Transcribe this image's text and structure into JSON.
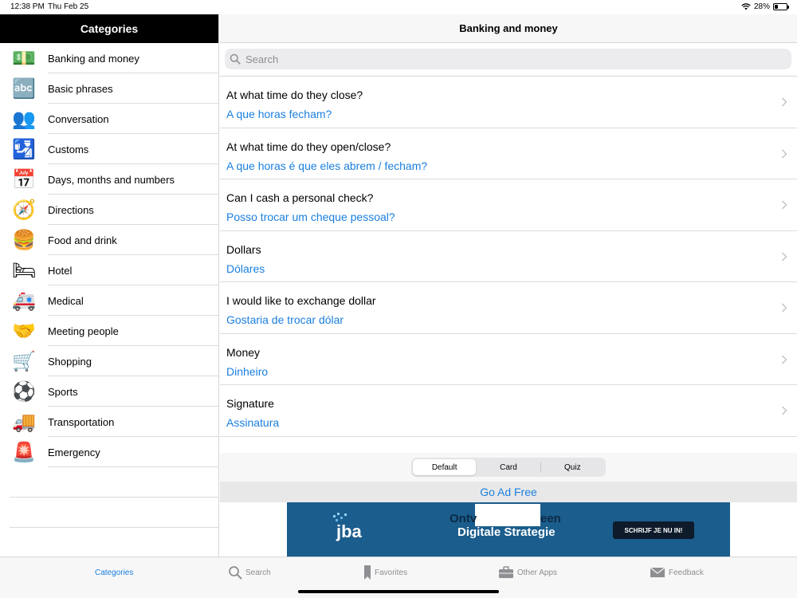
{
  "status": {
    "time": "12:38 PM",
    "date": "Thu Feb 25",
    "battery": "28%",
    "battery_level": 0.28
  },
  "sidebar": {
    "title": "Categories",
    "items": [
      {
        "label": "Banking and money",
        "icon": "money-icon"
      },
      {
        "label": "Basic phrases",
        "icon": "abc-icon"
      },
      {
        "label": "Conversation",
        "icon": "people-icon"
      },
      {
        "label": "Customs",
        "icon": "customs-officer-icon"
      },
      {
        "label": "Days, months and numbers",
        "icon": "calendar-icon"
      },
      {
        "label": "Directions",
        "icon": "compass-icon"
      },
      {
        "label": "Food and drink",
        "icon": "burger-icon"
      },
      {
        "label": "Hotel",
        "icon": "bed-icon"
      },
      {
        "label": "Medical",
        "icon": "ambulance-icon"
      },
      {
        "label": "Meeting people",
        "icon": "handshake-icon"
      },
      {
        "label": "Shopping",
        "icon": "shopping-cart-icon"
      },
      {
        "label": "Sports",
        "icon": "soccer-ball-icon"
      },
      {
        "label": "Transportation",
        "icon": "truck-icon"
      },
      {
        "label": "Emergency",
        "icon": "siren-icon"
      }
    ]
  },
  "main": {
    "title": "Banking and money",
    "search_placeholder": "Search",
    "phrases": [
      {
        "en": "At what time do they close?",
        "pt": "A que horas fecham?"
      },
      {
        "en": "At what time do they open/close?",
        "pt": "A que horas é que eles abrem / fecham?"
      },
      {
        "en": "Can I cash a personal check?",
        "pt": "Posso trocar um cheque pessoal?"
      },
      {
        "en": "Dollars",
        "pt": "Dólares"
      },
      {
        "en": "I would like to exchange dollar",
        "pt": "Gostaria de trocar dólar"
      },
      {
        "en": "Money",
        "pt": "Dinheiro"
      },
      {
        "en": "Signature",
        "pt": "Assinatura"
      }
    ],
    "modes": [
      "Default",
      "Card",
      "Quiz"
    ],
    "active_mode": "Default",
    "ad_free": "Go Ad Free",
    "banner": {
      "logo": "jba",
      "line1a": "Ontv",
      "line1b": "een",
      "line2": "Digitale Strategie",
      "cta": "SCHRIJF JE NU IN!"
    }
  },
  "tabs": [
    {
      "label": "Categories",
      "icon": "grid-icon",
      "active": true
    },
    {
      "label": "Search",
      "icon": "search-icon",
      "active": false
    },
    {
      "label": "Favorites",
      "icon": "bookmark-icon",
      "active": false
    },
    {
      "label": "Other Apps",
      "icon": "briefcase-icon",
      "active": false
    },
    {
      "label": "Feedback",
      "icon": "envelope-icon",
      "active": false
    }
  ],
  "colors": {
    "accent": "#1a7fe0",
    "header_bg": "#000000",
    "banner_bg": "#1b5d8c"
  }
}
